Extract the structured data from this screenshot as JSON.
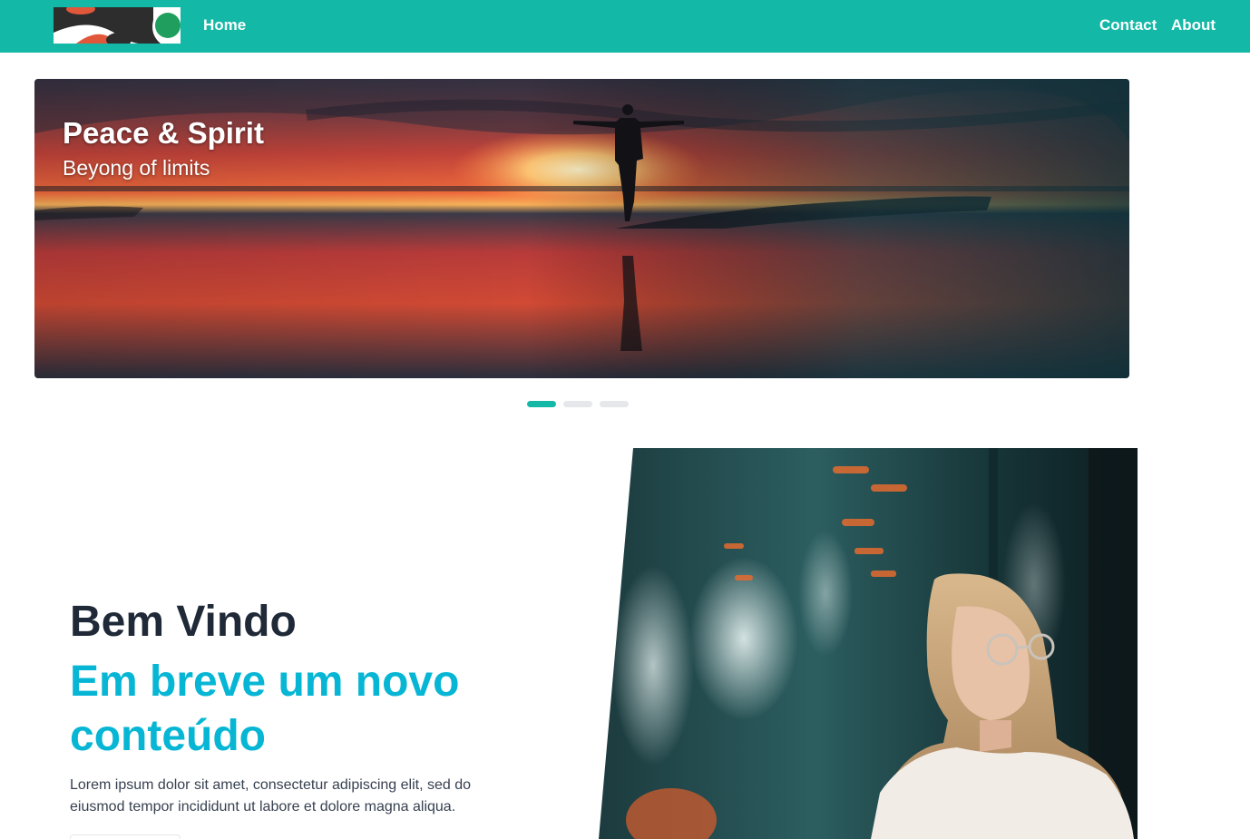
{
  "nav": {
    "logo": "brand-logo",
    "links": [
      "Home",
      "Contact",
      "About"
    ]
  },
  "hero": {
    "title": "Peace & Spirit",
    "subtitle": "Beyong of limits",
    "slides_total": 3,
    "active_slide": 1
  },
  "welcome": {
    "heading": "Bem Vindo",
    "subheading": "Em breve um novo conteúdo",
    "text": "Lorem ipsum dolor sit amet, consectetur adipiscing elit, sed do eiusmod tempor incididunt ut labore et dolore magna aliqua."
  },
  "colors": {
    "accent": "#14b8a6",
    "subheading": "#06b6d4",
    "heading": "#1f2937"
  }
}
